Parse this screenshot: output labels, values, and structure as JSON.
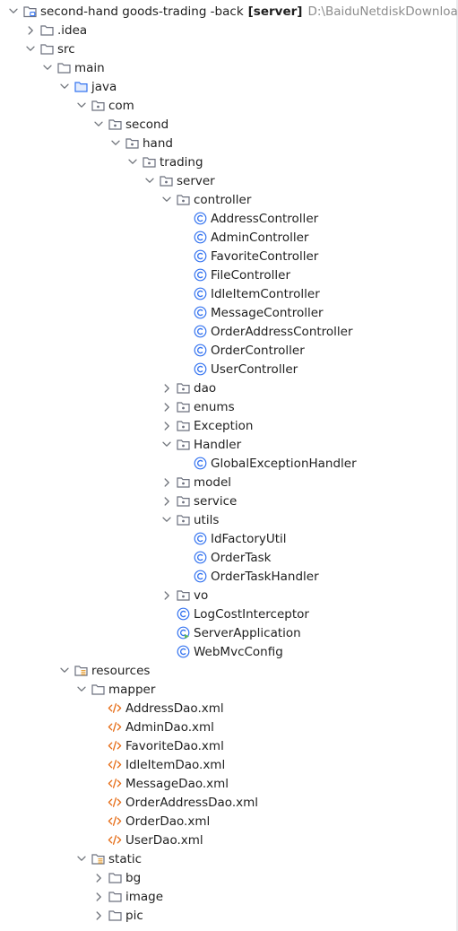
{
  "project": {
    "name": "second-hand goods-trading -back",
    "module_tag": "[server]",
    "path": "D:\\BaiduNetdiskDownload"
  },
  "tree": [
    {
      "label": "second-hand goods-trading -back",
      "level": 0,
      "type": "module",
      "state": "open"
    },
    {
      "label": ".idea",
      "level": 1,
      "type": "folder",
      "state": "closed"
    },
    {
      "label": "src",
      "level": 1,
      "type": "folder",
      "state": "open"
    },
    {
      "label": "main",
      "level": 2,
      "type": "folder",
      "state": "open"
    },
    {
      "label": "java",
      "level": 3,
      "type": "source-root",
      "state": "open"
    },
    {
      "label": "com",
      "level": 4,
      "type": "package",
      "state": "open"
    },
    {
      "label": "second",
      "level": 5,
      "type": "package",
      "state": "open"
    },
    {
      "label": "hand",
      "level": 6,
      "type": "package",
      "state": "open"
    },
    {
      "label": "trading",
      "level": 7,
      "type": "package",
      "state": "open"
    },
    {
      "label": "server",
      "level": 8,
      "type": "package",
      "state": "open"
    },
    {
      "label": "controller",
      "level": 9,
      "type": "package",
      "state": "open"
    },
    {
      "label": "AddressController",
      "level": 10,
      "type": "class",
      "state": "leaf"
    },
    {
      "label": "AdminController",
      "level": 10,
      "type": "class",
      "state": "leaf"
    },
    {
      "label": "FavoriteController",
      "level": 10,
      "type": "class",
      "state": "leaf"
    },
    {
      "label": "FileController",
      "level": 10,
      "type": "class",
      "state": "leaf"
    },
    {
      "label": "IdleItemController",
      "level": 10,
      "type": "class",
      "state": "leaf"
    },
    {
      "label": "MessageController",
      "level": 10,
      "type": "class",
      "state": "leaf"
    },
    {
      "label": "OrderAddressController",
      "level": 10,
      "type": "class",
      "state": "leaf"
    },
    {
      "label": "OrderController",
      "level": 10,
      "type": "class",
      "state": "leaf"
    },
    {
      "label": "UserController",
      "level": 10,
      "type": "class",
      "state": "leaf"
    },
    {
      "label": "dao",
      "level": 9,
      "type": "package",
      "state": "closed"
    },
    {
      "label": "enums",
      "level": 9,
      "type": "package",
      "state": "closed"
    },
    {
      "label": "Exception",
      "level": 9,
      "type": "package",
      "state": "closed"
    },
    {
      "label": "Handler",
      "level": 9,
      "type": "package",
      "state": "open"
    },
    {
      "label": "GlobalExceptionHandler",
      "level": 10,
      "type": "class",
      "state": "leaf"
    },
    {
      "label": "model",
      "level": 9,
      "type": "package",
      "state": "closed"
    },
    {
      "label": "service",
      "level": 9,
      "type": "package",
      "state": "closed"
    },
    {
      "label": "utils",
      "level": 9,
      "type": "package",
      "state": "open"
    },
    {
      "label": "IdFactoryUtil",
      "level": 10,
      "type": "class",
      "state": "leaf"
    },
    {
      "label": "OrderTask",
      "level": 10,
      "type": "class",
      "state": "leaf"
    },
    {
      "label": "OrderTaskHandler",
      "level": 10,
      "type": "class",
      "state": "leaf"
    },
    {
      "label": "vo",
      "level": 9,
      "type": "package",
      "state": "closed"
    },
    {
      "label": "LogCostInterceptor",
      "level": 9,
      "type": "class",
      "state": "leaf"
    },
    {
      "label": "ServerApplication",
      "level": 9,
      "type": "app-class",
      "state": "leaf"
    },
    {
      "label": "WebMvcConfig",
      "level": 9,
      "type": "class",
      "state": "leaf"
    },
    {
      "label": "resources",
      "level": 3,
      "type": "resources-root",
      "state": "open"
    },
    {
      "label": "mapper",
      "level": 4,
      "type": "folder",
      "state": "open"
    },
    {
      "label": "AddressDao.xml",
      "level": 5,
      "type": "xml",
      "state": "leaf"
    },
    {
      "label": "AdminDao.xml",
      "level": 5,
      "type": "xml",
      "state": "leaf"
    },
    {
      "label": "FavoriteDao.xml",
      "level": 5,
      "type": "xml",
      "state": "leaf"
    },
    {
      "label": "IdleItemDao.xml",
      "level": 5,
      "type": "xml",
      "state": "leaf"
    },
    {
      "label": "MessageDao.xml",
      "level": 5,
      "type": "xml",
      "state": "leaf"
    },
    {
      "label": "OrderAddressDao.xml",
      "level": 5,
      "type": "xml",
      "state": "leaf"
    },
    {
      "label": "OrderDao.xml",
      "level": 5,
      "type": "xml",
      "state": "leaf"
    },
    {
      "label": "UserDao.xml",
      "level": 5,
      "type": "xml",
      "state": "leaf"
    },
    {
      "label": "static",
      "level": 4,
      "type": "resources-root",
      "state": "open"
    },
    {
      "label": "bg",
      "level": 5,
      "type": "folder",
      "state": "closed"
    },
    {
      "label": "image",
      "level": 5,
      "type": "folder",
      "state": "closed"
    },
    {
      "label": "pic",
      "level": 5,
      "type": "folder",
      "state": "closed"
    }
  ],
  "colors": {
    "text": "#1f1f1f",
    "muted": "#8c8c8c",
    "chevron": "#6f737a",
    "folder": "#6c707e",
    "class_icon": "#3574f0",
    "xml_icon": "#e66d17",
    "resources_accent": "#e8a33d"
  }
}
